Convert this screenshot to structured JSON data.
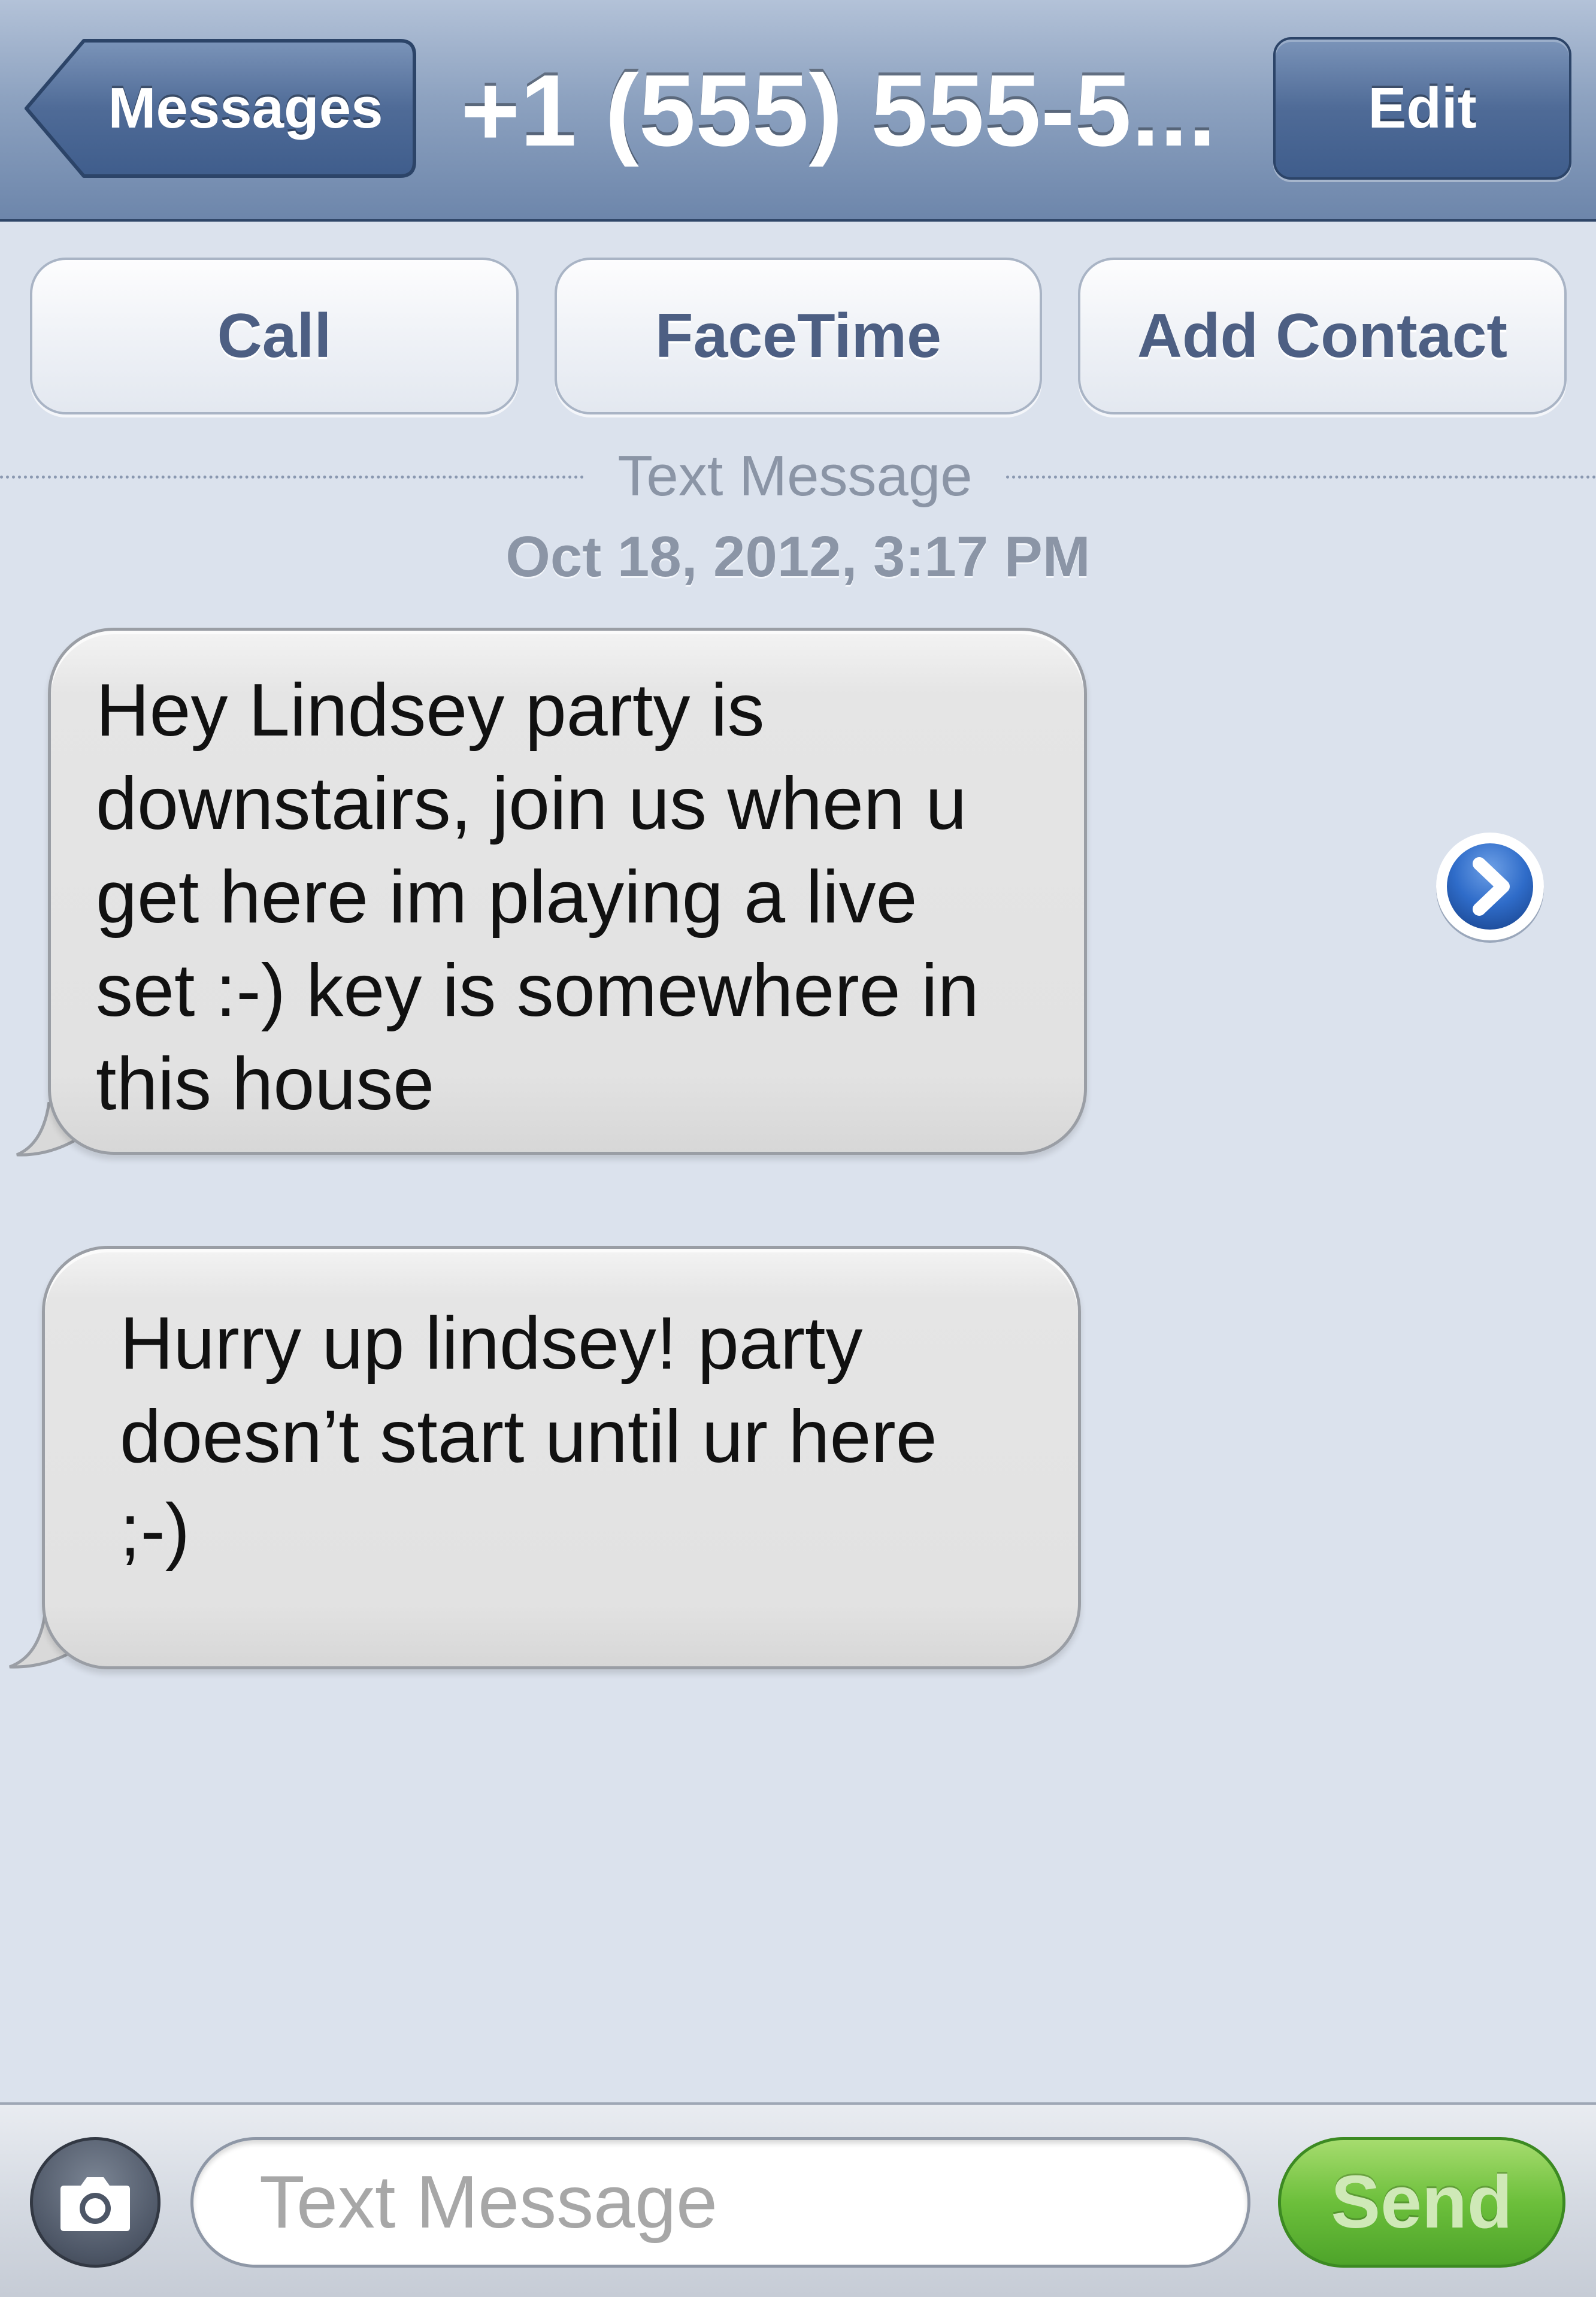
{
  "navbar": {
    "back_label": "Messages",
    "title": "+1 (555) 555-5...",
    "edit_label": "Edit"
  },
  "actions": {
    "call": "Call",
    "facetime": "FaceTime",
    "add_contact": "Add Contact"
  },
  "thread": {
    "service_label": "Text Message",
    "timestamp": "Oct 18, 2012, 3:17 PM",
    "messages": [
      {
        "direction": "incoming",
        "lines": [
          "Hey Lindsey party is",
          "downstairs, join us when u",
          "get here im playing a live",
          "set :-) key is somewhere in",
          "this house"
        ]
      },
      {
        "direction": "incoming",
        "lines": [
          "Hurry up lindsey! party",
          "doesn’t start until ur here",
          ";-)"
        ]
      }
    ],
    "detail_icon": "chevron-right-circle-icon"
  },
  "composer": {
    "camera_icon": "camera-icon",
    "placeholder": "Text Message",
    "value": "",
    "send_label": "Send"
  },
  "colors": {
    "background": "#dbe2ed",
    "nav_blue": "#6d86ab",
    "send_green": "#6cbf3b",
    "bubble_gray": "#e2e2e2",
    "action_text": "#4d5f83"
  }
}
